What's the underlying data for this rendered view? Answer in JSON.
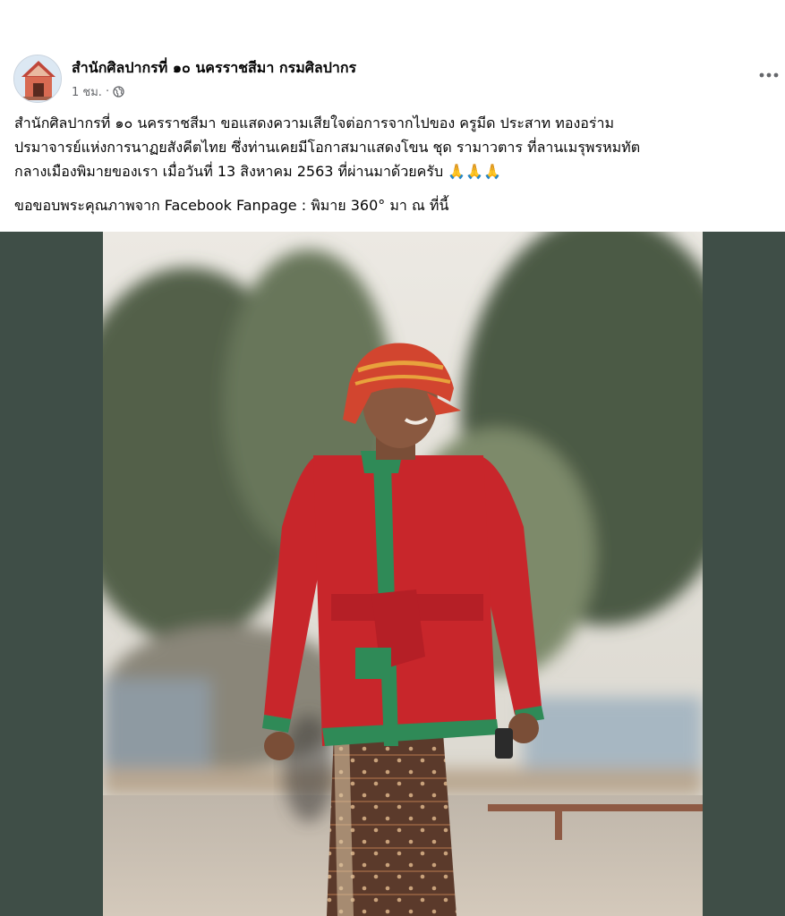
{
  "post": {
    "page_name": "สำนักศิลปากรที่ ๑๐ นครราชสีมา กรมศิลปากร",
    "time": "1 ชม.",
    "separator": "·",
    "audience_icon": "globe-icon",
    "more_icon": "more-options-icon",
    "text_lines": [
      "สำนักศิลปากรที่ ๑๐ นครราชสีมา ขอแสดงความเสียใจต่อการจากไปของ ครูมีด ประสาท ทองอร่าม",
      "ปรมาจารย์แห่งการนาฏยสังคีตไทย ซึ่งท่านเคยมีโอกาสมาแสดงโขน ชุด รามาวตาร ที่ลานเมรุพรหมทัต",
      "กลางเมืองพิมายของเรา เมื่อวันที่ 13 สิงหาคม 2563 ที่ผ่านมาด้วยครับ 🙏🙏🙏"
    ],
    "credit": "ขอขอบพระคุณภาพจาก Facebook Fanpage : พิมาย 360° มา ณ ที่นี้"
  },
  "colors": {
    "text": "#050505",
    "meta": "#65676b",
    "photo_frame": "#3f4e47",
    "shirt": "#c8262b",
    "trim": "#2f8a57"
  }
}
